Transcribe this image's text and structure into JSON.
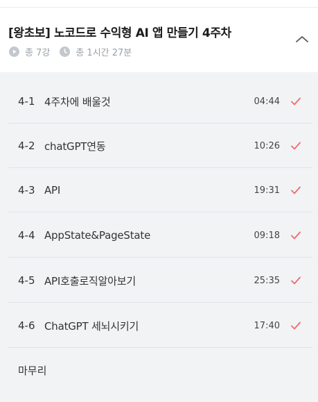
{
  "header": {
    "title": "[왕초보] 노코드로 수익형 AI 앱 만들기 4주차",
    "lesson_count": "총 7강",
    "total_time": "총 1시간 27분"
  },
  "colors": {
    "accent_check": "#ef6b6b",
    "list_background": "#f1f3f5"
  },
  "lessons": [
    {
      "number": "4-1",
      "title": "4주차에 배울것",
      "duration": "04:44",
      "completed": true
    },
    {
      "number": "4-2",
      "title": "chatGPT연동",
      "duration": "10:26",
      "completed": true
    },
    {
      "number": "4-3",
      "title": "API",
      "duration": "19:31",
      "completed": true
    },
    {
      "number": "4-4",
      "title": "AppState&PageState",
      "duration": "09:18",
      "completed": true
    },
    {
      "number": "4-5",
      "title": "API호출로직알아보기",
      "duration": "25:35",
      "completed": true
    },
    {
      "number": "4-6",
      "title": "ChatGPT 세뇌시키기",
      "duration": "17:40",
      "completed": true
    },
    {
      "number": "",
      "title": "마무리",
      "duration": "",
      "completed": false
    }
  ]
}
